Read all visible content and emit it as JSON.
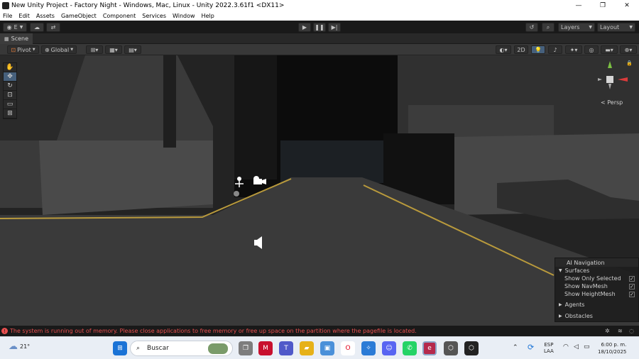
{
  "window": {
    "title": "New Unity Project - Factory Night - Windows, Mac, Linux - Unity 2022.3.61f1 <DX11>",
    "controls": {
      "minimize": "—",
      "maximize": "❐",
      "close": "✕"
    }
  },
  "menu": {
    "items": [
      "File",
      "Edit",
      "Assets",
      "GameObject",
      "Component",
      "Services",
      "Window",
      "Help"
    ]
  },
  "toolbar": {
    "account_label": "E",
    "play_icon": "play-icon",
    "pause_icon": "pause-icon",
    "step_icon": "step-icon",
    "layers_label": "Layers",
    "layout_label": "Layout"
  },
  "scene": {
    "tab_label": "Scene",
    "pivot_label": "Pivot",
    "global_label": "Global",
    "mode_2d": "2D",
    "persp_label": "< Persp"
  },
  "ai_navigation": {
    "title": "AI Navigation",
    "surfaces_label": "Surfaces",
    "options": [
      {
        "label": "Show Only Selected",
        "checked": true
      },
      {
        "label": "Show NavMesh",
        "checked": true
      },
      {
        "label": "Show HeightMesh",
        "checked": true
      }
    ],
    "agents_label": "Agents",
    "obstacles_label": "Obstacles"
  },
  "status": {
    "message": "The system is running out of memory. Please close applications to free memory or free up space on the partition where the pagefile is located.",
    "color": "#e84f4f"
  },
  "taskbar": {
    "weather_temp": "21°",
    "search_placeholder": "Buscar",
    "language": "ESP",
    "keyboard": "LAA",
    "time": "6:00 p. m.",
    "date": "18/10/2025"
  }
}
